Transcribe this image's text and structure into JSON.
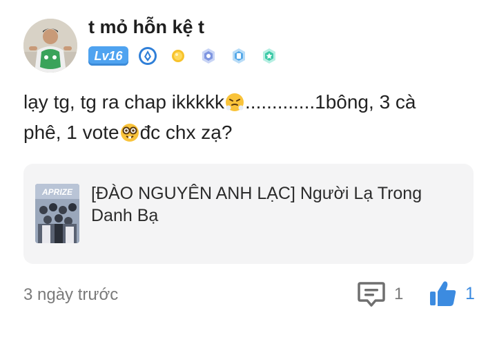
{
  "post": {
    "username": "t mỏ hỗn kệ t",
    "level": "Lv16",
    "content_line1_a": "lạy tg, tg ra chap ikkkkk",
    "content_line1_b": ".............1bông, 3 cà",
    "content_line2_a": "phê, 1 vote",
    "content_line2_b": "đc chx zạ?",
    "badges": [
      "diamond-badge-icon",
      "gold-coin-badge-icon",
      "hexagon-badge-icon",
      "shield-badge-icon",
      "star-badge-icon"
    ]
  },
  "card": {
    "title_line1": "[ĐÀO NGUYÊN ANH LẠC] Người Lạ Trong",
    "title_line2": "Danh Bạ",
    "thumb_text": "APRIZE"
  },
  "footer": {
    "timestamp": "3 ngày trước",
    "comment_count": "1",
    "like_count": "1"
  },
  "colors": {
    "accent": "#3c8be0",
    "level_bg": "#4fa3f0",
    "card_bg": "#f4f4f5"
  }
}
